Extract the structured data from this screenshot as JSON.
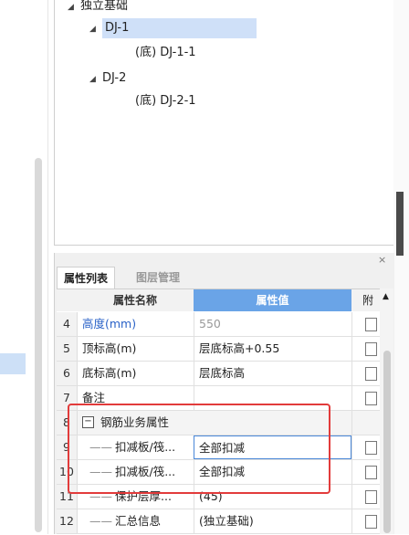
{
  "tree": {
    "items": [
      {
        "label": "独立基础",
        "arrow": "◢",
        "level": 0
      },
      {
        "label": "DJ-1",
        "arrow": "◢",
        "level": 1,
        "selected": true
      },
      {
        "label": "(底)  DJ-1-1",
        "arrow": "",
        "level": 2
      },
      {
        "label": "DJ-2",
        "arrow": "◢",
        "level": 1
      },
      {
        "label": "(底)  DJ-2-1",
        "arrow": "",
        "level": 2
      }
    ]
  },
  "panel": {
    "close_glyph": "×",
    "tabs": [
      {
        "label": "属性列表",
        "active": true
      },
      {
        "label": "图层管理",
        "active": false
      }
    ],
    "columns": {
      "name": "属性名称",
      "value": "属性值",
      "attach": "附"
    },
    "rows": [
      {
        "num": "4",
        "name": "高度(mm)",
        "value": "550",
        "name_style": "blue",
        "value_style": "gray",
        "checkbox": true
      },
      {
        "num": "5",
        "name": "顶标高(m)",
        "value": "层底标高+0.55",
        "checkbox": true
      },
      {
        "num": "6",
        "name": "底标高(m)",
        "value": "层底标高",
        "checkbox": true
      },
      {
        "num": "7",
        "name": "备注",
        "value": "",
        "checkbox": true
      },
      {
        "num": "8",
        "name": "钢筋业务属性",
        "value": "",
        "group": true,
        "checkbox": false
      },
      {
        "num": "9",
        "name": "扣减板/筏...",
        "value": "全部扣减",
        "child": true,
        "editing": true,
        "checkbox": true
      },
      {
        "num": "10",
        "name": "扣减板/筏...",
        "value": "全部扣减",
        "child": true,
        "checkbox": true
      },
      {
        "num": "11",
        "name": "保护层厚...",
        "value": "(45)",
        "child": true,
        "checkbox": true
      },
      {
        "num": "12",
        "name": "汇总信息",
        "value": "(独立基础)",
        "child": true,
        "checkbox": true
      }
    ]
  },
  "colors": {
    "header_value_bg": "#6aa4e7",
    "selection_bg": "#cfe0f8",
    "highlight_box": "#e23b3b",
    "blue_text": "#2b63c8"
  }
}
